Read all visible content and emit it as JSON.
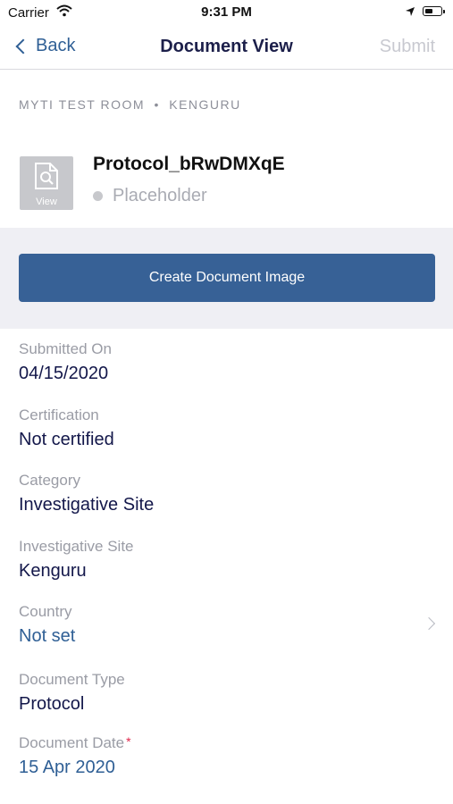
{
  "status_bar": {
    "carrier": "Carrier",
    "time": "9:31 PM"
  },
  "nav": {
    "back_label": "Back",
    "title": "Document View",
    "submit_label": "Submit"
  },
  "breadcrumb": {
    "room": "MYTI TEST ROOM",
    "separator": "•",
    "site": "KENGURU"
  },
  "document": {
    "thumbnail_label": "View",
    "name": "Protocol_bRwDMXqE",
    "status": "Placeholder"
  },
  "actions": {
    "create_image_label": "Create Document Image"
  },
  "fields": {
    "submitted_on": {
      "label": "Submitted On",
      "value": "04/15/2020"
    },
    "certification": {
      "label": "Certification",
      "value": "Not certified"
    },
    "category": {
      "label": "Category",
      "value": "Investigative Site"
    },
    "investigative_site": {
      "label": "Investigative Site",
      "value": "Kenguru"
    },
    "country": {
      "label": "Country",
      "value": "Not set"
    },
    "document_type": {
      "label": "Document Type",
      "value": "Protocol"
    },
    "document_date": {
      "label": "Document Date",
      "required_mark": "*",
      "value": "15 Apr 2020"
    }
  },
  "colors": {
    "accent": "#376196",
    "link": "#2f5f95",
    "required": "#e0264a"
  },
  "icons": [
    "wifi-icon",
    "location-arrow-icon",
    "battery-icon",
    "chevron-left-icon",
    "document-search-icon",
    "chevron-right-icon"
  ]
}
